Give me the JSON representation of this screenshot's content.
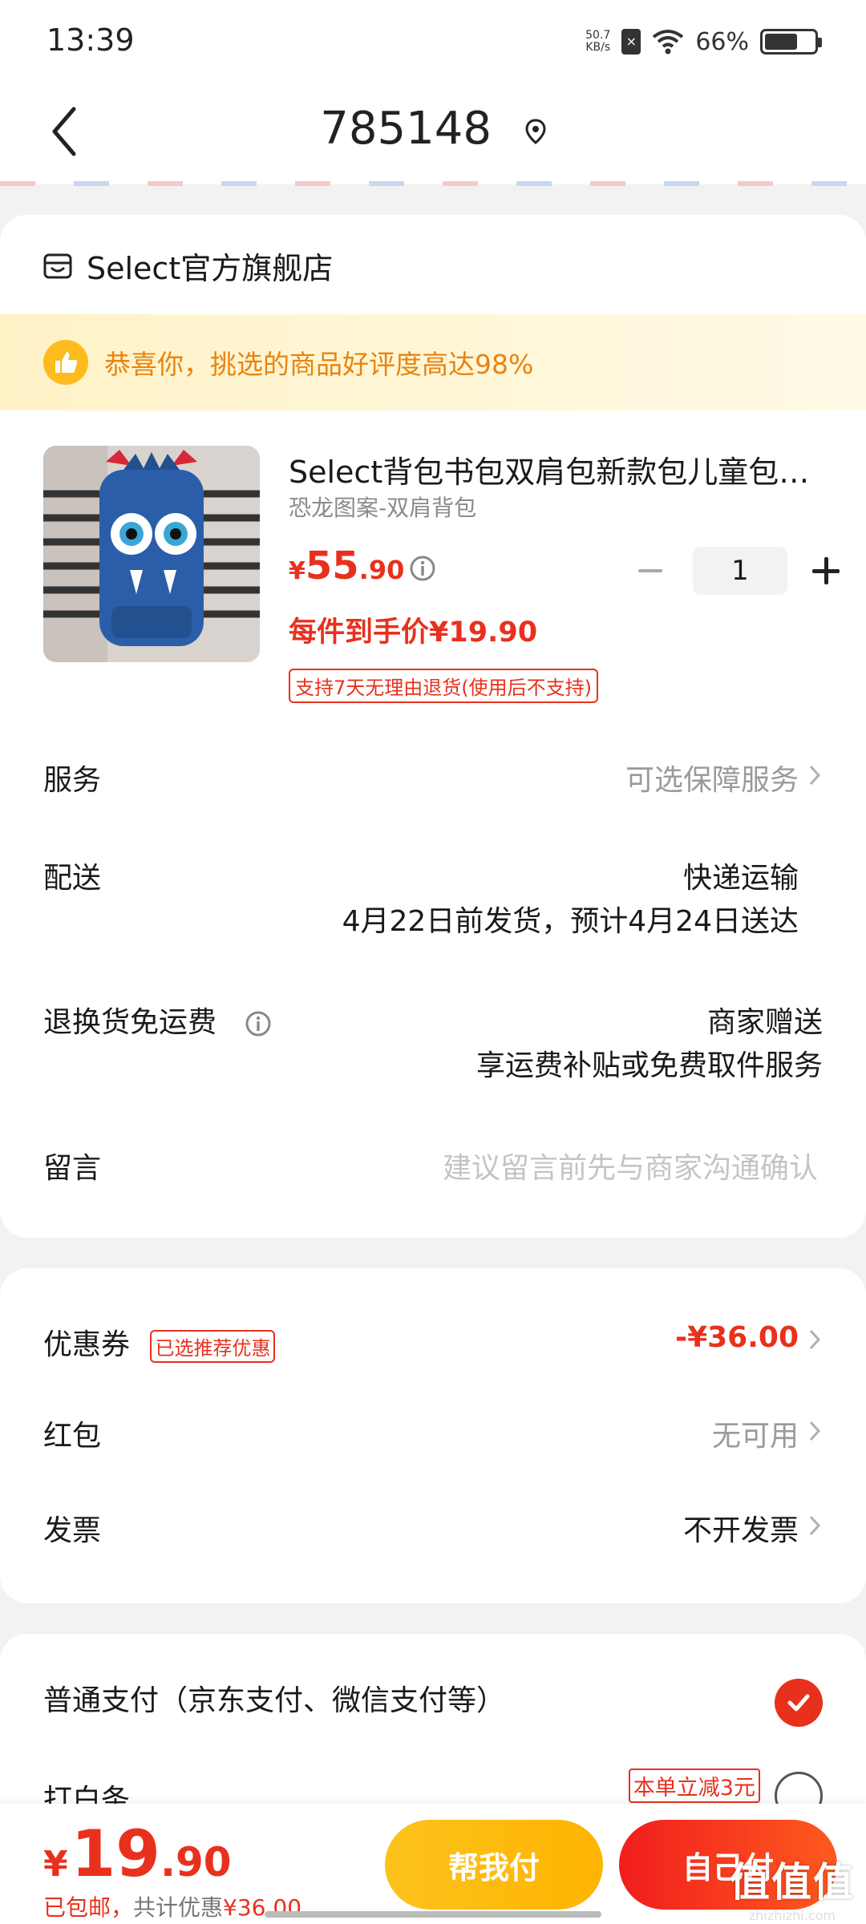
{
  "status": {
    "time": "13:39",
    "net_speed_value": "50.7",
    "net_speed_unit": "KB/s",
    "battery": "66%",
    "battery_level": 0.66
  },
  "nav": {
    "title": "785148"
  },
  "shop": {
    "name": "Select官方旗舰店"
  },
  "notice": {
    "text": "恭喜你，挑选的商品好评度高达98%"
  },
  "product": {
    "title": "Select背包书包双肩包新款包儿童包书包小学生幼儿园",
    "subtitle": "恐龙图案-双肩背包",
    "price_currency": "¥",
    "price_int": "55",
    "price_dec": ".90",
    "quantity": "1",
    "each_price": "每件到手价¥19.90",
    "return_tag": "支持7天无理由退货(使用后不支持)"
  },
  "rows": {
    "service_label": "服务",
    "service_value": "可选保障服务",
    "delivery_label": "配送",
    "delivery_value": "快递运输",
    "delivery_detail": "4月22日前发货，预计4月24日送达",
    "return_label": "退换货免运费",
    "return_value": "商家赠送",
    "return_detail": "享运费补贴或免费取件服务",
    "message_label": "留言",
    "message_placeholder": "建议留言前先与商家沟通确认"
  },
  "discounts": {
    "coupon_label": "优惠券",
    "coupon_tag": "已选推荐优惠",
    "coupon_value": "-¥36.00",
    "redpacket_label": "红包",
    "redpacket_value": "无可用",
    "invoice_label": "发票",
    "invoice_value": "不开发票"
  },
  "payment": {
    "normal_label": "普通支付（京东支付、微信支付等）",
    "baitiao_label": "打白条",
    "baitiao_tag": "本单立减3元"
  },
  "bottom": {
    "total_currency": "¥",
    "total_int": "19",
    "total_dec": ".90",
    "free_shipping": "已包邮，",
    "saved_prefix": "共计优惠",
    "saved_amount": "¥36.00",
    "help_pay": "帮我付",
    "self_pay": "自己付"
  },
  "watermark": {
    "big": "值值值",
    "small": "zhizhizhi.com"
  },
  "colors": {
    "accent_red": "#e8311d",
    "accent_yellow": "#fcc21c",
    "notice_text": "#e88410"
  }
}
